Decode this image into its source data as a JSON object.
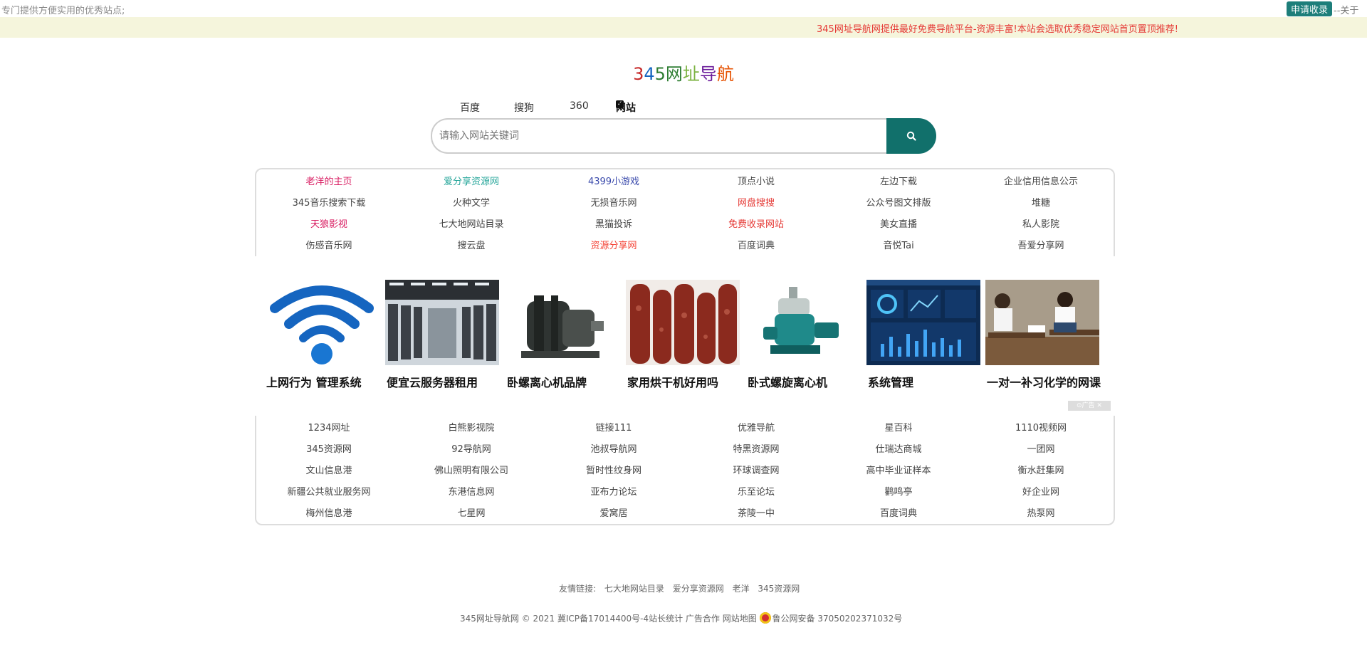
{
  "topbar": {
    "tagline": "专门提供方便实用的优秀站点;",
    "apply": "申请收录",
    "about": "--关于"
  },
  "notice": "345网址导航网提供最好免费导航平台-资源丰富!本站会选取优秀稳定网站首页置顶推荐!",
  "logo": {
    "chars": [
      "3",
      "4",
      "5",
      "网",
      "址",
      "导",
      "航"
    ]
  },
  "colors": {
    "logo": [
      "#c62828",
      "#1565c0",
      "#2e7d32",
      "#2e7d32",
      "#7cb342",
      "#6a1b9a",
      "#e65100"
    ],
    "accent": "#11706b",
    "notice_bg": "#f5f5dc",
    "notice_text": "#e53935"
  },
  "tabs": {
    "baidu": "百度",
    "sogou": "搜狗",
    "s360": "360",
    "site": "网站"
  },
  "search": {
    "placeholder": "请输入网站关键词",
    "icon": "search-icon"
  },
  "top_links": [
    [
      "老洋的主页",
      "爱分享资源网",
      "4399小游戏",
      "顶点小说",
      "左边下载",
      "企业信用信息公示"
    ],
    [
      "345音乐搜索下载",
      "火种文学",
      "无损音乐网",
      "网盘搜搜",
      "公众号图文排版",
      "堆糖"
    ],
    [
      "天狼影视",
      "七大地网站目录",
      "黑猫投诉",
      "免费收录网站",
      "美女直播",
      "私人影院"
    ],
    [
      "伤感音乐网",
      "搜云盘",
      "资源分享网",
      "百度词典",
      "音悦Tai",
      "吾爱分享网"
    ]
  ],
  "top_link_colors": [
    [
      "#d81b60",
      "#26a69a",
      "#3949ab",
      "#444",
      "#444",
      "#444"
    ],
    [
      "#444",
      "#444",
      "#444",
      "#e53935",
      "#444",
      "#444"
    ],
    [
      "#d81b60",
      "#444",
      "#444",
      "#e53935",
      "#444",
      "#444"
    ],
    [
      "#444",
      "#444",
      "#f44336",
      "#444",
      "#444",
      "#444"
    ]
  ],
  "ads": [
    {
      "caption": "上网行为 管理系统"
    },
    {
      "caption": "便宜云服务器租用"
    },
    {
      "caption": "卧螺离心机品牌"
    },
    {
      "caption": "家用烘干机好用吗"
    },
    {
      "caption": "卧式螺旋离心机"
    },
    {
      "caption": "系统管理"
    },
    {
      "caption": "一对一补习化学的网课"
    }
  ],
  "ad_badge": "⊙广告 ✕",
  "bottom_links": [
    [
      "1234网址",
      "白熊影视院",
      "链接111",
      "优雅导航",
      "星百科",
      "1110视频网"
    ],
    [
      "345资源网",
      "92导航网",
      "池叔导航网",
      "特黑资源网",
      "仕瑞达商城",
      "一团网"
    ],
    [
      "文山信息港",
      "佛山照明有限公司",
      "暂时性纹身网",
      "环球调查网",
      "高中毕业证样本",
      "衡水赶集网"
    ],
    [
      "新疆公共就业服务网",
      "东港信息网",
      "亚布力论坛",
      "乐至论坛",
      "鹳鸣亭",
      "好企业网"
    ],
    [
      "梅州信息港",
      "七星网",
      "爱窝居",
      "茶陵一中",
      "百度词典",
      "热泵网"
    ]
  ],
  "friends": {
    "label": "友情链接:",
    "items": [
      "七大地网站目录",
      "爱分享资源网",
      "老洋",
      "345资源网"
    ]
  },
  "footer": {
    "text": "345网址导航网 © 2021 冀ICP备17014400号-4站长统计 广告合作 网站地图",
    "police": "鲁公网安备 37050202371032号"
  }
}
